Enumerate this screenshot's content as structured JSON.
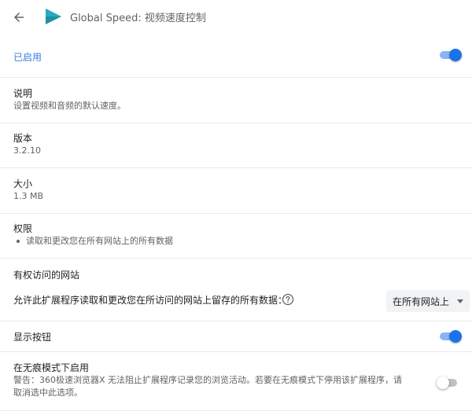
{
  "header": {
    "title": "Global Speed: 视频速度控制",
    "back_icon": "arrow-left-icon",
    "extension_icon": "play-triangle-icon",
    "brand_color": "#1f8fa6"
  },
  "enabled": {
    "label": "已启用",
    "state": true,
    "color": "#3b7be0"
  },
  "description": {
    "label": "说明",
    "value": "设置视频和音频的默认速度。"
  },
  "version": {
    "label": "版本",
    "value": "3.2.10"
  },
  "size": {
    "label": "大小",
    "value": "1.3 MB"
  },
  "permissions": {
    "label": "权限",
    "items": [
      "读取和更改您在所有网站上的所有数据"
    ]
  },
  "site_access": {
    "heading": "有权访问的网站",
    "description": "允许此扩展程序读取和更改您在所访问的网站上留存的所有数据：",
    "help_icon": "help-circle-icon",
    "selected": "在所有网站上"
  },
  "show_button": {
    "label": "显示按钮",
    "state": true
  },
  "incognito": {
    "label": "在无痕模式下启用",
    "warning_line1": "警告：360极速浏览器X 无法阻止扩展程序记录您的浏览活动。若要在无痕模式下停用该扩展程序，请",
    "warning_line2": "取消选中此选项。",
    "state": false
  }
}
